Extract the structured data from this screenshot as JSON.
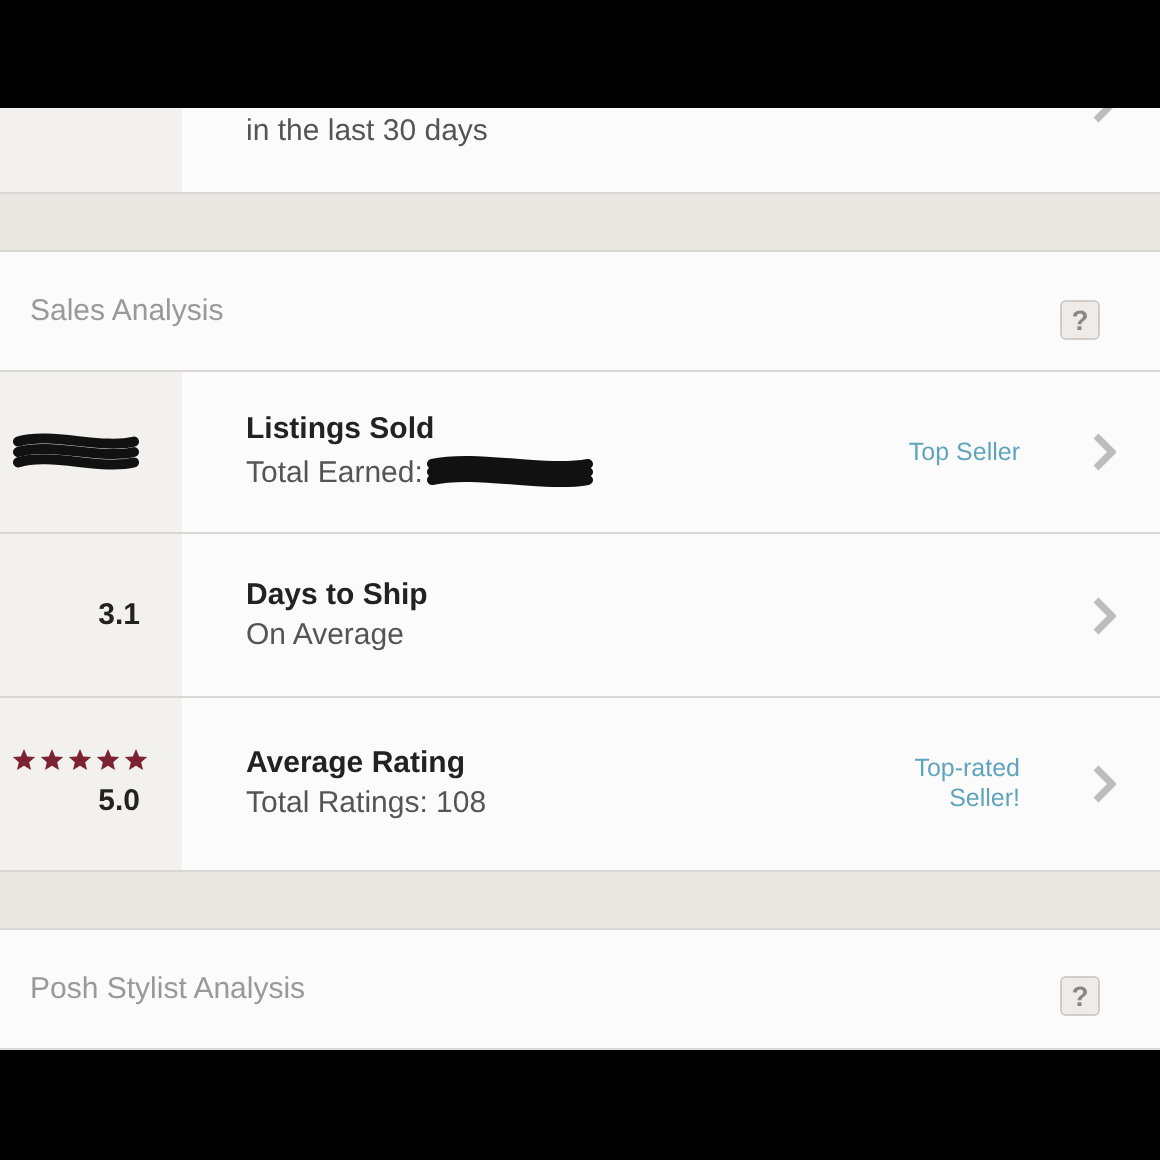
{
  "top_row": {
    "subtitle": "in the last 30 days"
  },
  "sections": [
    {
      "title": "Sales Analysis",
      "help": "?",
      "rows": [
        {
          "kind": "redacted",
          "title": "Listings Sold",
          "subtitle": "Total Earned:",
          "subtitle_redacted": true,
          "badge_lines": [
            "Top Seller"
          ]
        },
        {
          "kind": "value",
          "value": "3.1",
          "title": "Days to Ship",
          "subtitle": "On Average",
          "subtitle_redacted": false
        },
        {
          "kind": "rating",
          "stars": 5,
          "value": "5.0",
          "title": "Average Rating",
          "subtitle": "Total Ratings: 108",
          "subtitle_redacted": false,
          "badge_lines": [
            "Top-rated",
            "Seller!"
          ]
        }
      ]
    },
    {
      "title": "Posh Stylist Analysis",
      "help": "?"
    }
  ]
}
